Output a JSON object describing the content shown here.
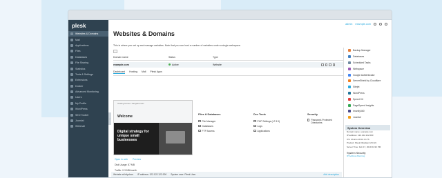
{
  "app": {
    "brand": "plesk"
  },
  "topbar": {
    "user": "admin",
    "domain": "example.com"
  },
  "sidebar": {
    "items": [
      {
        "label": "Websites & Domains",
        "active": true
      },
      {
        "label": "Mail"
      },
      {
        "label": "Applications"
      },
      {
        "label": "Files"
      },
      {
        "label": "Databases"
      },
      {
        "label": "File Sharing"
      },
      {
        "label": "Statistics"
      },
      {
        "label": "Tools & Settings"
      },
      {
        "label": "Extensions"
      },
      {
        "label": "Docker"
      },
      {
        "label": "Advanced Monitoring"
      },
      {
        "label": "Users"
      },
      {
        "label": "My Profile"
      },
      {
        "label": "WordPress"
      },
      {
        "label": "SEO Toolkit"
      },
      {
        "label": "Joomla!"
      },
      {
        "label": "Webmail"
      }
    ]
  },
  "main": {
    "title": "Websites & Domains",
    "intro": "This is where you set up and manage websites. Note that you can host a number of websites under a single webspace.",
    "columns": [
      "Domain name",
      "Status",
      "Type"
    ],
    "row": {
      "domain": "example.com",
      "status": "Active",
      "type": "Website"
    },
    "subtabs": [
      "Dashboard",
      "Hosting",
      "Mail",
      "Plesk Apps"
    ],
    "preview": {
      "header": "Heading Number / Navigation links",
      "welcome": "Welcome",
      "headline": "Digital strategy for unique small businesses"
    },
    "preview_links": [
      "Open in web",
      "Preview"
    ],
    "disk_usage": "Disk Usage: 87 MB",
    "traffic": "Traffic: 0.3 MB/month",
    "stats_links": [
      "Web Statistics",
      "Web Statistics SSL/TLS"
    ],
    "files_db": {
      "title": "Files & Databases",
      "items": [
        "File Manager",
        "Databases",
        "FTP Access"
      ]
    },
    "dev_tools": {
      "title": "Dev Tools",
      "items": [
        "PHP Settings (v7.3.9)",
        "Logs",
        "Applications"
      ]
    },
    "security": {
      "title": "Security",
      "items": [
        "Password-Protected Directories"
      ]
    }
  },
  "footer": {
    "website_at": "Website at httpdocs",
    "ip": "IP address: 122.122.122.000",
    "sysuser": "System user: Plesk User",
    "add_desc": "Add description"
  },
  "rightpanel": {
    "items": [
      {
        "label": "Backup Manager",
        "color": "#e57f3b"
      },
      {
        "label": "Databases",
        "color": "#3f7fc1"
      },
      {
        "label": "Scheduled Tasks",
        "color": "#6f8aa0"
      },
      {
        "label": "Webspace",
        "color": "#9b59b6"
      },
      {
        "label": "Google Authenticator",
        "color": "#4285f4"
      },
      {
        "label": "ServerShield by Cloudflare",
        "color": "#f38020"
      },
      {
        "label": "Sitejet",
        "color": "#28aade"
      },
      {
        "label": "WordPress",
        "color": "#21759b"
      },
      {
        "label": "Speed Kit",
        "color": "#e23d3d"
      },
      {
        "label": "PageSpeed Insights",
        "color": "#34a853"
      },
      {
        "label": "Imunify360",
        "color": "#4a4a8c"
      },
      {
        "label": "Joomla!",
        "color": "#f4a11b"
      }
    ],
    "system_overview": "System Overview",
    "sys_rows": [
      "Domain name: example.com",
      "IP address: 122.122.122.000",
      "OS: Ubuntu 18.04.3 LTS",
      "Product: Plesk Obsidian 18.0.19",
      "Server Time: Feb 17, 2019 04:32 PM"
    ],
    "security_title": "System Security",
    "security_link": "IP Address Banning"
  }
}
